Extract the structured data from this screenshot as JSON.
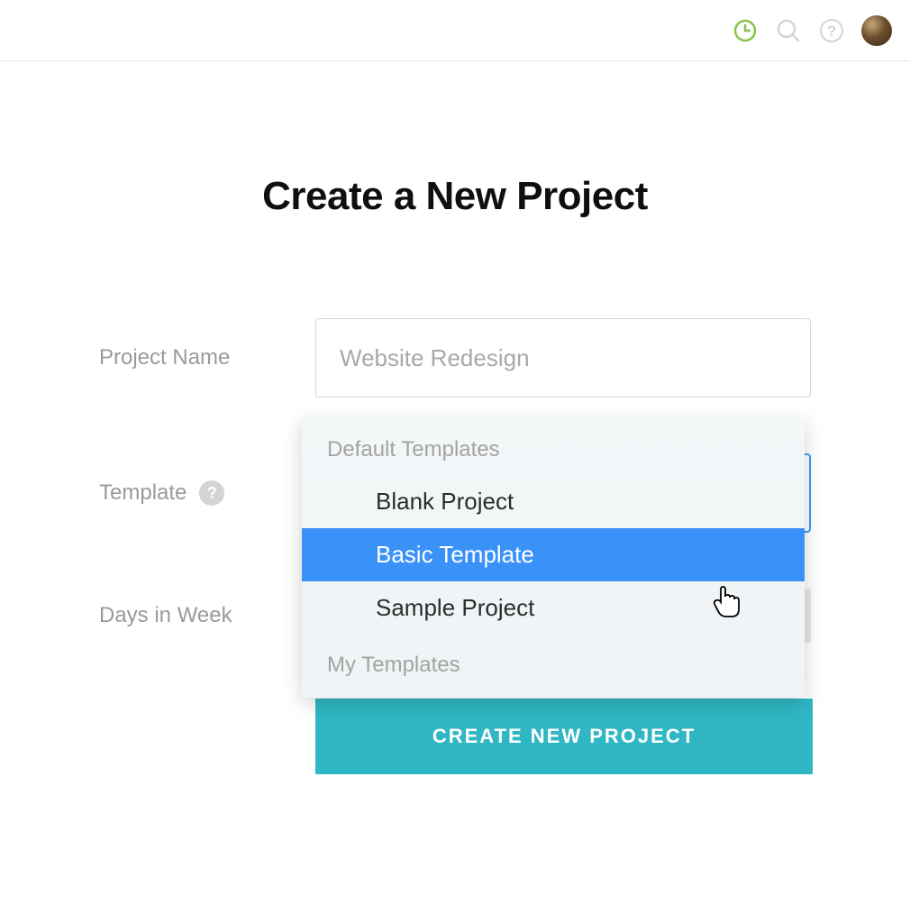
{
  "header": {
    "icons": {
      "clock": "clock-icon",
      "search": "search-icon",
      "help": "help-icon",
      "avatar": "user-avatar"
    }
  },
  "page": {
    "title": "Create a New Project"
  },
  "form": {
    "projectName": {
      "label": "Project Name",
      "placeholder": "Website Redesign",
      "value": ""
    },
    "template": {
      "label": "Template",
      "groups": [
        {
          "label": "Default Templates",
          "options": [
            {
              "label": "Blank Project",
              "selected": false
            },
            {
              "label": "Basic Template",
              "selected": true
            },
            {
              "label": "Sample Project",
              "selected": false
            }
          ]
        },
        {
          "label": "My Templates",
          "options": []
        }
      ]
    },
    "daysInWeek": {
      "label": "Days in Week"
    },
    "submit": {
      "label": "CREATE NEW PROJECT"
    }
  },
  "colors": {
    "accent_green": "#8bc34a",
    "select_blue": "#3a91f7",
    "button_teal": "#2fb7c3"
  }
}
